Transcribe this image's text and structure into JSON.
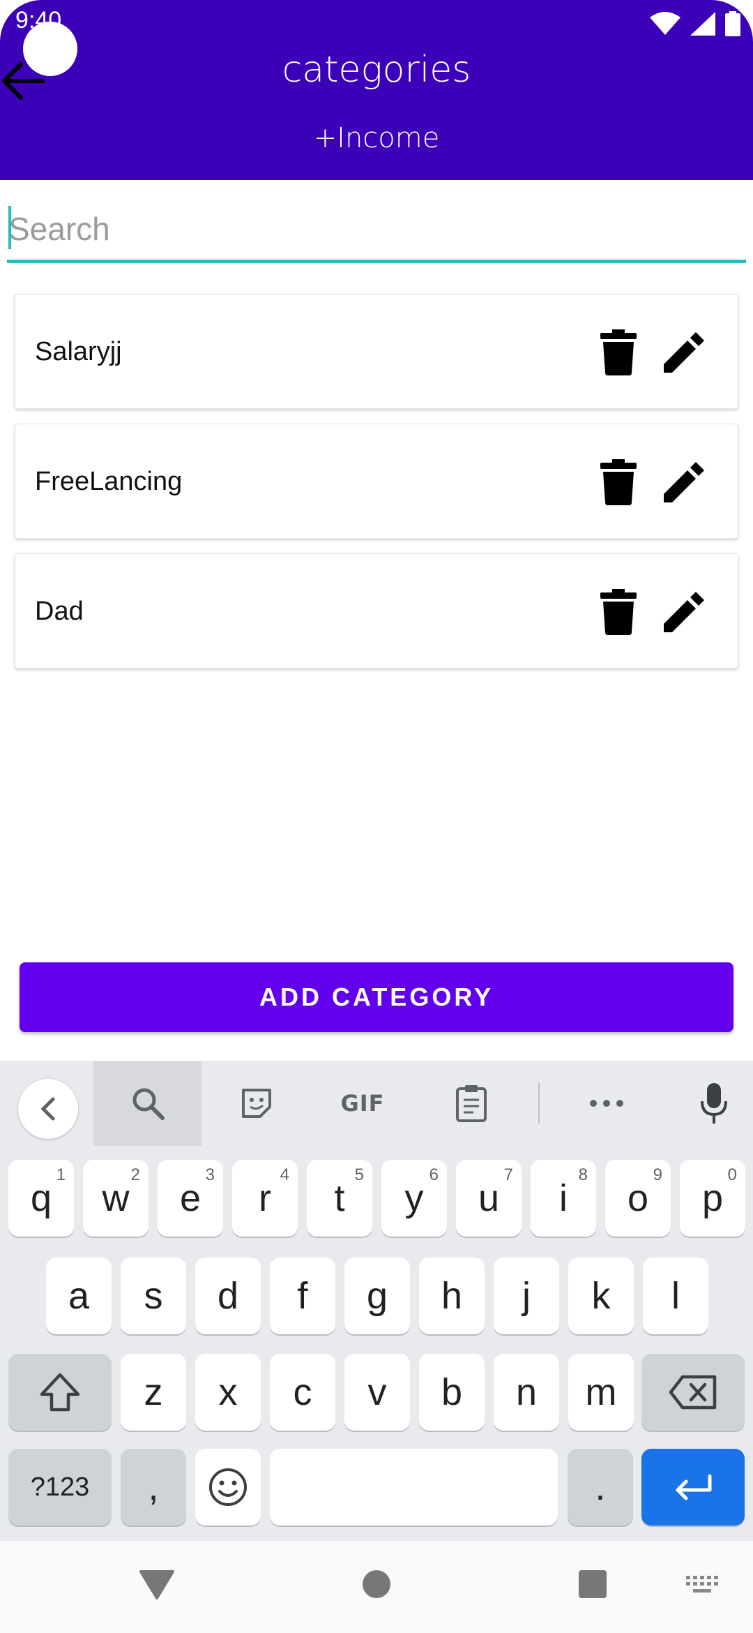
{
  "status_bar": {
    "time": "9:40"
  },
  "header": {
    "title": "categories",
    "subtitle": "+Income"
  },
  "search": {
    "placeholder": "Search",
    "value": ""
  },
  "categories": [
    {
      "label": "Salaryjj"
    },
    {
      "label": "FreeLancing"
    },
    {
      "label": "Dad"
    }
  ],
  "add_button": {
    "label": "ADD CATEGORY"
  },
  "colors": {
    "header_bg": "#3c00b9",
    "accent": "#6200ee",
    "search_underline": "#1fbfb8",
    "enter_key": "#1a73e8"
  },
  "keyboard": {
    "toolbar": {
      "gif_label": "GIF"
    },
    "row1": [
      {
        "k": "q",
        "h": "1"
      },
      {
        "k": "w",
        "h": "2"
      },
      {
        "k": "e",
        "h": "3"
      },
      {
        "k": "r",
        "h": "4"
      },
      {
        "k": "t",
        "h": "5"
      },
      {
        "k": "y",
        "h": "6"
      },
      {
        "k": "u",
        "h": "7"
      },
      {
        "k": "i",
        "h": "8"
      },
      {
        "k": "o",
        "h": "9"
      },
      {
        "k": "p",
        "h": "0"
      }
    ],
    "row2": [
      "a",
      "s",
      "d",
      "f",
      "g",
      "h",
      "j",
      "k",
      "l"
    ],
    "row3": [
      "z",
      "x",
      "c",
      "v",
      "b",
      "n",
      "m"
    ],
    "symbols_label": "?123",
    "comma_label": ",",
    "period_label": "."
  },
  "icons": {
    "back": "arrow-left-icon",
    "delete": "trash-icon",
    "edit": "pencil-icon",
    "wifi": "wifi-icon",
    "signal": "signal-icon",
    "battery": "battery-icon",
    "kb_back": "chevron-left-icon",
    "kb_search": "search-icon",
    "kb_sticker": "sticker-icon",
    "kb_clipboard": "clipboard-icon",
    "kb_more": "more-icon",
    "kb_mic": "microphone-icon",
    "shift": "shift-icon",
    "backspace": "backspace-icon",
    "emoji": "emoji-icon",
    "enter": "enter-icon",
    "nav_back": "nav-back-icon",
    "nav_home": "nav-home-icon",
    "nav_recents": "nav-recents-icon",
    "nav_keyboard": "keyboard-icon"
  }
}
